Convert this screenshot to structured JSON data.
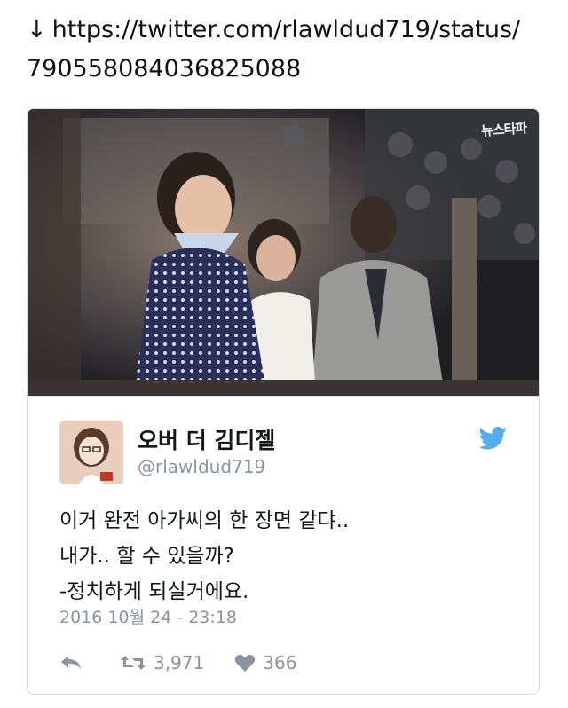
{
  "link": {
    "arrow": "↓",
    "url_line1": "https://twitter.com/rlawldud719/status/",
    "url_line2": "790558084036825088"
  },
  "media": {
    "watermark": "뉴스타파"
  },
  "tweet": {
    "display_name": "오버 더 김디젤",
    "handle": "@rlawldud719",
    "lines": [
      "이거 완전 아가씨의 한 장면 같댜..",
      "내가.. 할 수 있을까?",
      "-정치하게 되실거에요."
    ],
    "timestamp": "2016 10월 24 - 23:18",
    "retweets": "3,971",
    "likes": "366"
  },
  "icons": {
    "reply": "reply-icon",
    "retweet": "retweet-icon",
    "like": "heart-icon",
    "twitter": "twitter-bird-icon"
  },
  "colors": {
    "twitter_blue": "#55acee",
    "muted_gray": "#8a949e"
  }
}
